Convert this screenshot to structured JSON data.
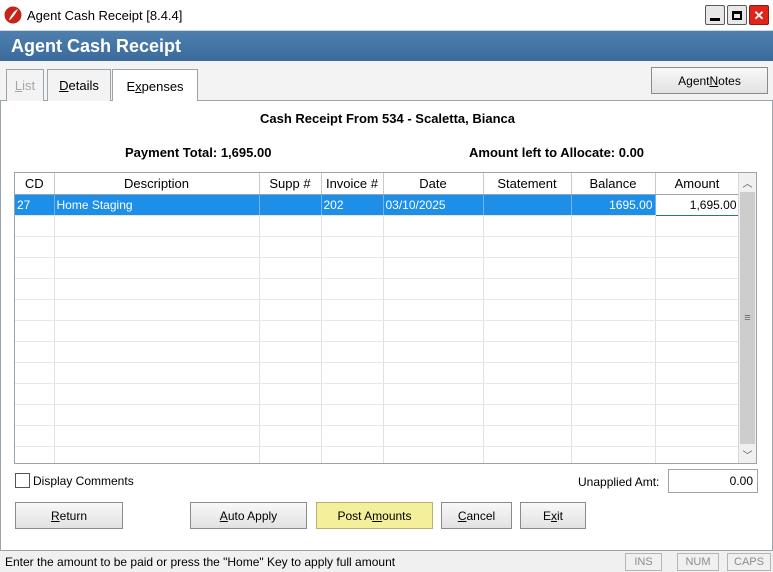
{
  "window": {
    "title": "Agent Cash Receipt [8.4.4]",
    "header_title": "Agent Cash Receipt",
    "icon": "feather-logo-icon",
    "accent_color": "#3a6b9c"
  },
  "tabs": [
    {
      "label_pre": "",
      "label_u": "L",
      "label_post": "ist",
      "enabled": false
    },
    {
      "label_pre": "",
      "label_u": "D",
      "label_post": "etails",
      "enabled": true
    },
    {
      "label_pre": "E",
      "label_u": "x",
      "label_post": "penses",
      "enabled": true,
      "active": true
    }
  ],
  "agent_notes": {
    "pre": "Agent ",
    "u": "N",
    "post": "otes"
  },
  "receipt_title": "Cash Receipt From 534 - Scaletta, Bianca",
  "payment_total": "Payment Total: 1,695.00",
  "amount_left": "Amount left to Allocate: 0.00",
  "grid": {
    "columns": [
      "CD",
      "Description",
      "Supp #",
      "Invoice #",
      "Date",
      "Statement",
      "Balance",
      "Amount"
    ],
    "rows": [
      {
        "cd": "27",
        "description": "Home Staging",
        "supp": "",
        "invoice": "202",
        "date": "03/10/2025",
        "statement": "",
        "balance": "1695.00",
        "amount": "1,695.00"
      }
    ],
    "selected_color": "#1e8fe8"
  },
  "display_comments_label": "Display Comments",
  "display_comments_checked": false,
  "unapplied": {
    "label": "Unapplied Amt:",
    "value": "0.00"
  },
  "buttons": {
    "return": {
      "u": "R",
      "post": "eturn"
    },
    "auto_apply": {
      "u": "A",
      "post": "uto Apply"
    },
    "post_amounts": {
      "pre": "Post A",
      "u": "m",
      "post": "ounts"
    },
    "cancel": {
      "u": "C",
      "post": "ancel"
    },
    "exit": {
      "pre": "E",
      "u": "x",
      "post": "it"
    }
  },
  "status": {
    "message": "Enter the amount to be paid or press the \"Home\" Key to apply full amount",
    "ins": "INS",
    "num": "NUM",
    "caps": "CAPS"
  }
}
